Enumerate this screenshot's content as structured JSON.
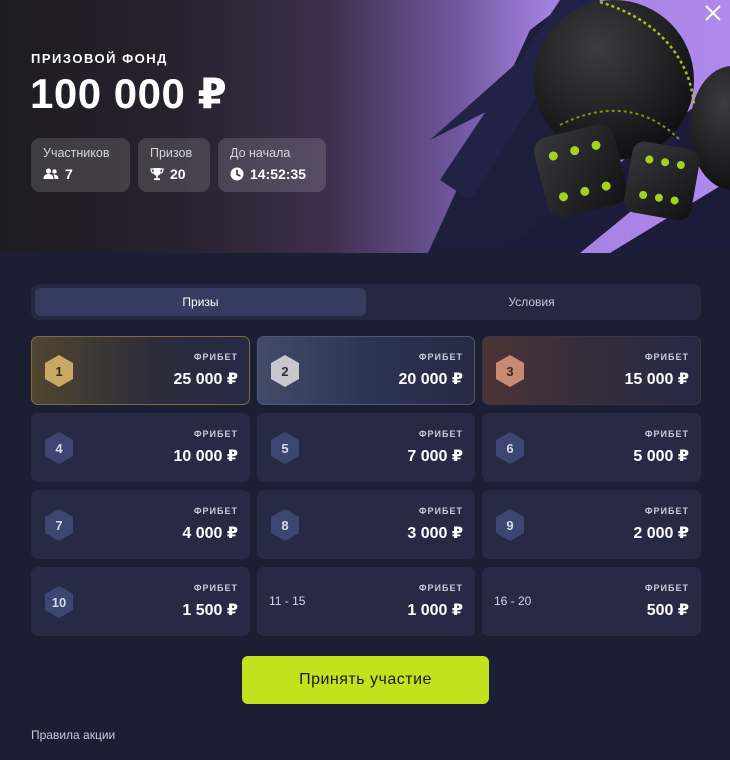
{
  "hero": {
    "pool_label": "ПРИЗОВОЙ ФОНД",
    "pool_amount": "100 000 ₽",
    "stats": {
      "participants": {
        "label": "Участников",
        "value": "7",
        "icon": "users-icon"
      },
      "prizes": {
        "label": "Призов",
        "value": "20",
        "icon": "trophy-icon"
      },
      "countdown": {
        "label": "До начала",
        "value": "14:52:35",
        "icon": "clock-icon"
      }
    }
  },
  "tabs": [
    {
      "label": "Призы",
      "active": true
    },
    {
      "label": "Условия",
      "active": false
    }
  ],
  "prizes": [
    {
      "place": "1",
      "kind": "ФРИБЕТ",
      "amount": "25 000 ₽",
      "tier": "gold"
    },
    {
      "place": "2",
      "kind": "ФРИБЕТ",
      "amount": "20 000 ₽",
      "tier": "silver"
    },
    {
      "place": "3",
      "kind": "ФРИБЕТ",
      "amount": "15 000 ₽",
      "tier": "bronze"
    },
    {
      "place": "4",
      "kind": "ФРИБЕТ",
      "amount": "10 000 ₽"
    },
    {
      "place": "5",
      "kind": "ФРИБЕТ",
      "amount": "7 000 ₽"
    },
    {
      "place": "6",
      "kind": "ФРИБЕТ",
      "amount": "5 000 ₽"
    },
    {
      "place": "7",
      "kind": "ФРИБЕТ",
      "amount": "4 000 ₽"
    },
    {
      "place": "8",
      "kind": "ФРИБЕТ",
      "amount": "3 000 ₽"
    },
    {
      "place": "9",
      "kind": "ФРИБЕТ",
      "amount": "2 000 ₽"
    },
    {
      "place": "10",
      "kind": "ФРИБЕТ",
      "amount": "1 500 ₽"
    },
    {
      "range": "11 - 15",
      "kind": "ФРИБЕТ",
      "amount": "1 000 ₽"
    },
    {
      "range": "16 - 20",
      "kind": "ФРИБЕТ",
      "amount": "500 ₽"
    }
  ],
  "cta_label": "Принять участие",
  "rules_link": "Правила акции",
  "colors": {
    "accent": "#c1e21d",
    "background": "#1c1f33",
    "card": "#262a45",
    "gold": "#c9a766",
    "silver": "#c8c8cc",
    "bronze": "#c98a73",
    "badge": "#3d4670"
  }
}
